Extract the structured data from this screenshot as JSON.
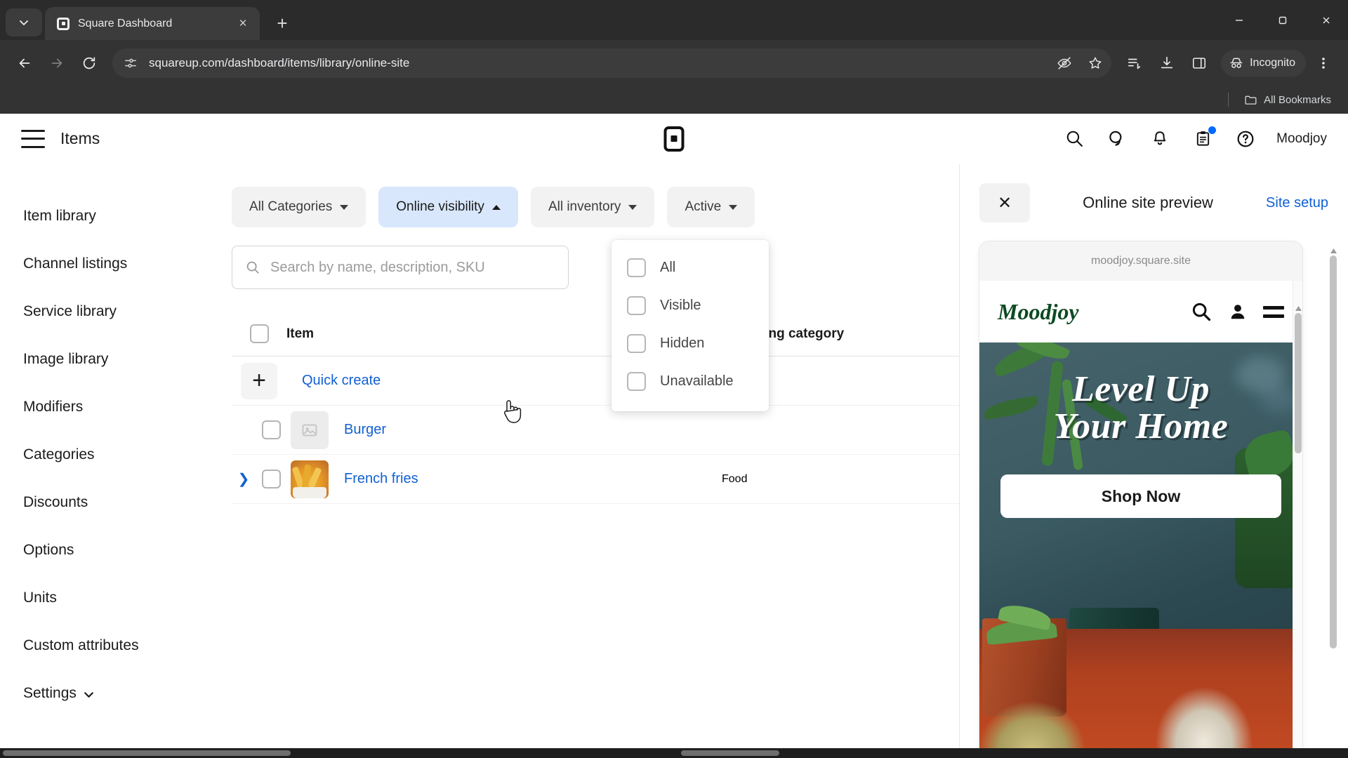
{
  "browser": {
    "tab": {
      "title": "Square Dashboard",
      "favicon": "square-logo-icon",
      "close": "×"
    },
    "tab_search_icon": "chevron-down-icon",
    "new_tab_icon": "plus-icon",
    "window": {
      "minimize": "minimize-icon",
      "maximize": "maximize-icon",
      "close": "close-icon"
    },
    "nav": {
      "back": "back-arrow-icon",
      "forward": "forward-arrow-icon",
      "reload": "reload-icon"
    },
    "omnibox": {
      "site_info_icon": "site-settings-icon",
      "url": "squareup.com/dashboard/items/library/online-site",
      "tracking_protection_icon": "eye-slash-icon",
      "bookmark_icon": "star-icon"
    },
    "actions": {
      "reading_list_icon": "reading-list-icon",
      "downloads_icon": "download-icon",
      "side_panel_icon": "side-panel-icon",
      "menu_icon": "three-dot-menu-icon"
    },
    "incognito": {
      "label": "Incognito",
      "icon": "incognito-icon"
    },
    "bookmarks": {
      "all_label": "All Bookmarks",
      "folder_icon": "folder-icon"
    }
  },
  "app": {
    "header": {
      "menu_icon": "hamburger-menu-icon",
      "title": "Items",
      "logo": "square-logo-icon",
      "icons": [
        {
          "name": "search-icon"
        },
        {
          "name": "messages-icon"
        },
        {
          "name": "notifications-bell-icon"
        },
        {
          "name": "tasks-clipboard-icon",
          "badge": true
        }
      ],
      "help_icon": "help-circle-icon",
      "account_name": "Moodjoy"
    },
    "sidebar": {
      "items": [
        {
          "label": "Item library",
          "active": true
        },
        {
          "label": "Channel listings"
        },
        {
          "label": "Service library"
        },
        {
          "label": "Image library"
        },
        {
          "label": "Modifiers"
        },
        {
          "label": "Categories"
        },
        {
          "label": "Discounts"
        },
        {
          "label": "Options"
        },
        {
          "label": "Units"
        },
        {
          "label": "Custom attributes"
        },
        {
          "label": "Settings",
          "chevron": "chevron-down-icon"
        }
      ]
    },
    "filters": [
      {
        "label": "All Categories",
        "state": "default",
        "chevron": "down"
      },
      {
        "label": "Online visibility",
        "state": "active",
        "chevron": "up"
      },
      {
        "label": "All inventory",
        "state": "default",
        "chevron": "down"
      },
      {
        "label": "Active",
        "state": "default",
        "chevron": "down"
      }
    ],
    "dropdown": {
      "open_for": "Online visibility",
      "options": [
        {
          "label": "All",
          "checked": false
        },
        {
          "label": "Visible",
          "checked": false
        },
        {
          "label": "Hidden",
          "checked": false
        },
        {
          "label": "Unavailable",
          "checked": false
        }
      ]
    },
    "search": {
      "placeholder": "Search by name, description, SKU",
      "value": "",
      "icon": "search-icon"
    },
    "table": {
      "headers": {
        "item": "Item",
        "reporting_category": "Reporting category"
      },
      "select_all_checkbox": false,
      "quick_create": {
        "label": "Quick create",
        "icon": "plus-icon"
      },
      "rows": [
        {
          "name": "Burger",
          "category": "",
          "checked": false,
          "thumb": "image-placeholder-icon",
          "expandable": false
        },
        {
          "name": "French fries",
          "category": "Food",
          "checked": false,
          "thumb": "french-fries-photo",
          "expandable": true,
          "expand_icon": "chevron-right-icon"
        }
      ]
    },
    "preview": {
      "close_icon": "close-icon",
      "title": "Online site preview",
      "site_setup_link": "Site setup",
      "site": {
        "url": "moodjoy.square.site",
        "logo": "Moodjoy",
        "nav_icons": [
          {
            "name": "search-icon"
          },
          {
            "name": "account-person-icon"
          },
          {
            "name": "menu-burger-icon"
          }
        ],
        "hero": {
          "title_line1": "Level Up",
          "title_line2": "Your Home",
          "cta": "Shop Now"
        }
      }
    },
    "colors": {
      "link_blue": "#1160d4",
      "filter_active_bg": "#d8e7fb",
      "badge_blue": "#006aff",
      "brand_green": "#0d4a22"
    }
  }
}
